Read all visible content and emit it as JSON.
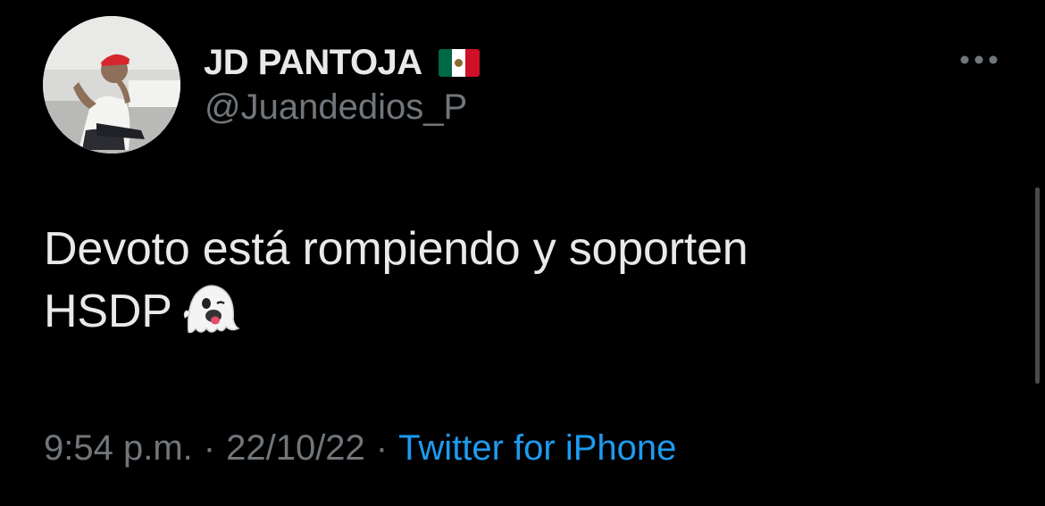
{
  "author": {
    "display_name": "JD PANTOJA",
    "handle": "@Juandedios_P",
    "flag_icon": "mexico-flag-icon",
    "flag_colors": {
      "green": "#006847",
      "white": "#ffffff",
      "red": "#ce1126"
    }
  },
  "tweet": {
    "line1": "Devoto está rompiendo y soporten",
    "line2": "HSDP",
    "emoji_icon": "ghost-emoji-icon"
  },
  "meta": {
    "time": "9:54 p.m.",
    "separator": "·",
    "date": "22/10/22",
    "source": "Twitter for iPhone"
  },
  "more_icon": "more-horizontal-icon",
  "colors": {
    "background": "#000000",
    "primary_text": "#e7e9ea",
    "secondary_text": "#71767b",
    "link": "#1d9bf0"
  }
}
